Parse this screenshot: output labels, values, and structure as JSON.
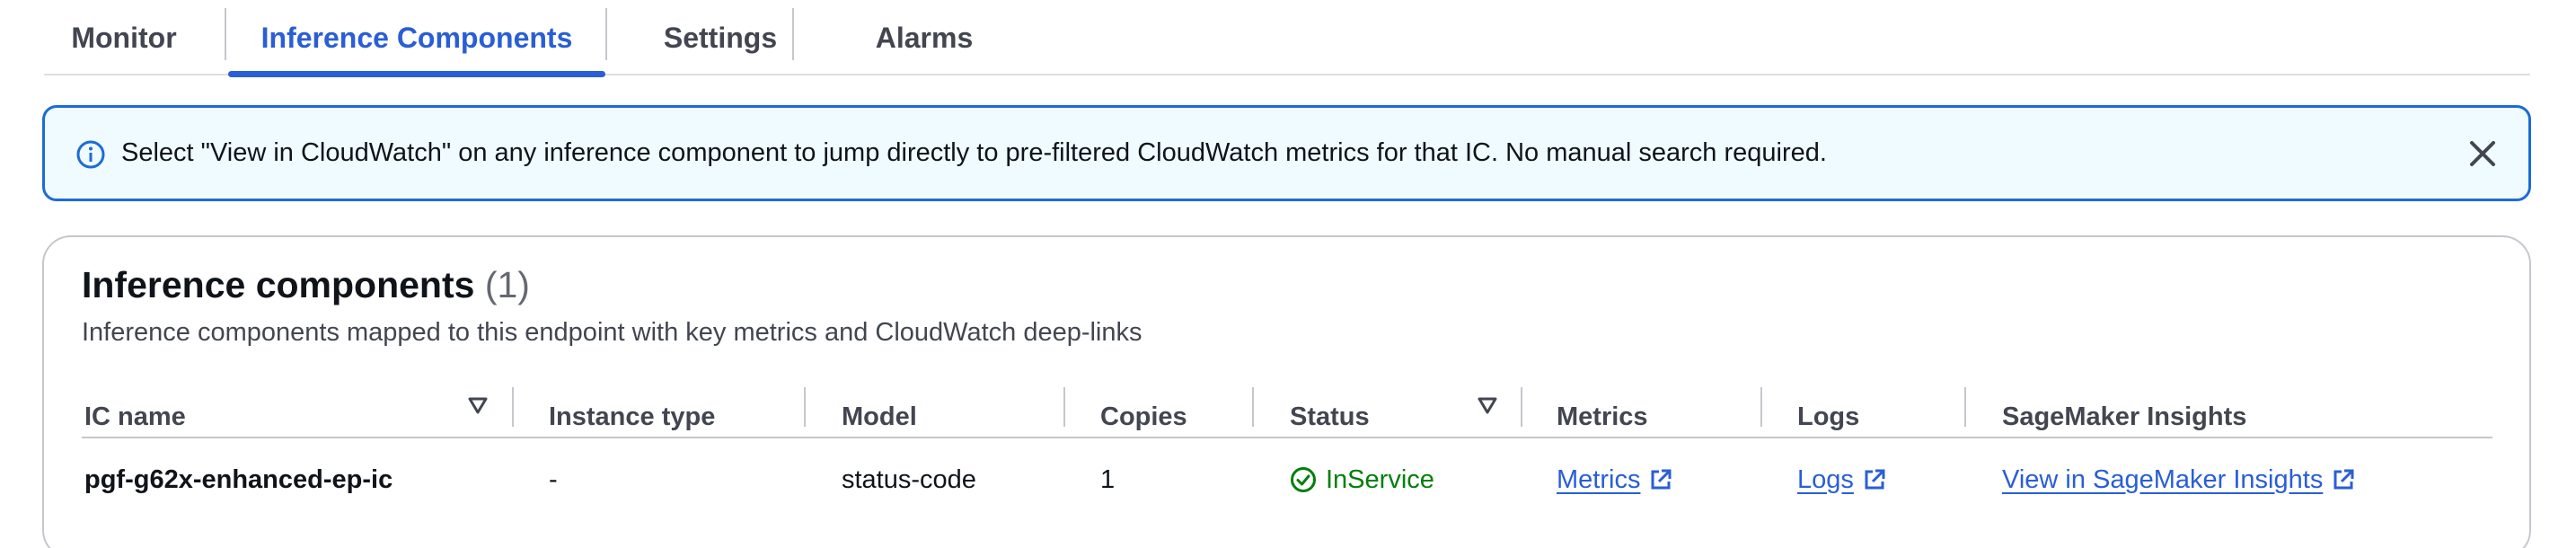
{
  "tabs": [
    {
      "label": "Monitor"
    },
    {
      "label": "Inference Components"
    },
    {
      "label": "Settings"
    },
    {
      "label": "Alarms"
    }
  ],
  "active_tab": "Inference Components",
  "banner": {
    "message": "Select \"View in CloudWatch\" on any inference component to jump directly to pre-filtered CloudWatch metrics for that IC. No manual search required.",
    "icon": "info-icon",
    "close_icon": "close-icon"
  },
  "panel": {
    "title": "Inference components",
    "count": "(1)",
    "description": "Inference components mapped to this endpoint with key metrics and CloudWatch deep-links"
  },
  "table": {
    "columns": [
      "IC name",
      "Instance type",
      "Model",
      "Copies",
      "Status",
      "Metrics",
      "Logs",
      "SageMaker Insights"
    ],
    "rows": [
      {
        "ic_name": "pgf-g62x-enhanced-ep-ic",
        "instance_type": "-",
        "model": "status-code",
        "copies": "1",
        "status": "InService",
        "metrics": "Metrics",
        "logs": "Logs",
        "insights": "View in SageMaker Insights"
      }
    ]
  },
  "colors": {
    "accent": "#295ed6",
    "success": "#037f0c",
    "banner_border": "#1d6bd6",
    "banner_bg": "#f0fbff"
  }
}
